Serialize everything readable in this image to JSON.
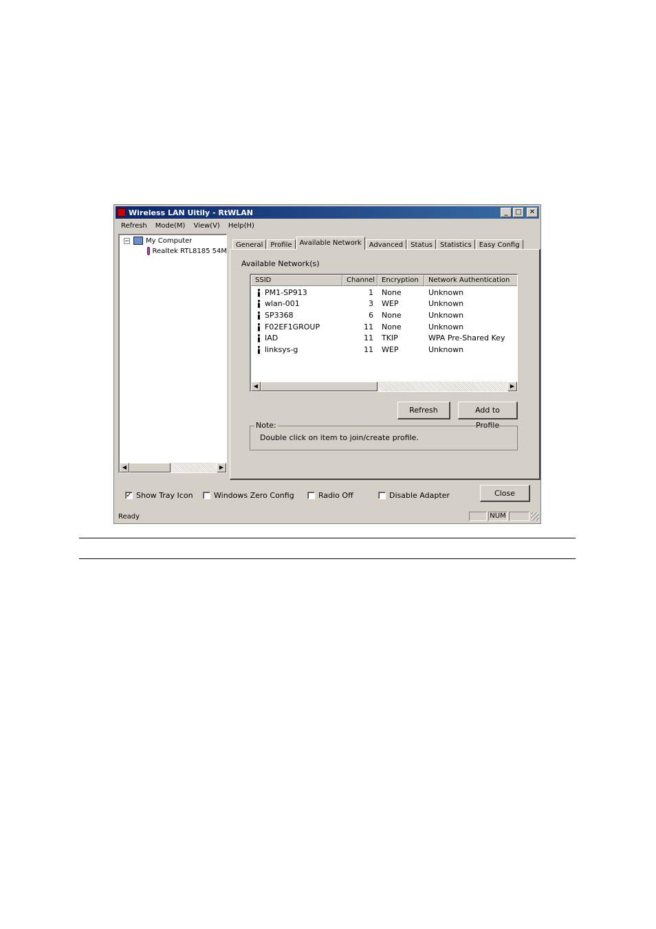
{
  "window": {
    "title": "Wireless LAN Uitily - RtWLAN",
    "minimize_glyph": "_",
    "maximize_glyph": "□",
    "close_glyph": "✕"
  },
  "menu": [
    "Refresh",
    "Mode(M)",
    "View(V)",
    "Help(H)"
  ],
  "tree": {
    "root_expander": "−",
    "root_label": "My Computer",
    "child_label": "Realtek RTL8185 54M"
  },
  "tabs": [
    "General",
    "Profile",
    "Available Network",
    "Advanced",
    "Status",
    "Statistics",
    "Easy Config"
  ],
  "active_tab": "Available Network",
  "available": {
    "section_label": "Available Network(s)",
    "columns": [
      "SSID",
      "Channel",
      "Encryption",
      "Network Authentication"
    ],
    "rows": [
      {
        "ssid": "PM1-SP913",
        "channel": "1",
        "encryption": "None",
        "auth": "Unknown"
      },
      {
        "ssid": "wlan-001",
        "channel": "3",
        "encryption": "WEP",
        "auth": "Unknown"
      },
      {
        "ssid": "SP3368",
        "channel": "6",
        "encryption": "None",
        "auth": "Unknown"
      },
      {
        "ssid": "F02EF1GROUP",
        "channel": "11",
        "encryption": "None",
        "auth": "Unknown"
      },
      {
        "ssid": "IAD",
        "channel": "11",
        "encryption": "TKIP",
        "auth": "WPA Pre-Shared Key"
      },
      {
        "ssid": "linksys-g",
        "channel": "11",
        "encryption": "WEP",
        "auth": "Unknown"
      }
    ],
    "refresh_label": "Refresh",
    "add_profile_label": "Add to Profile",
    "note_legend": "Note:",
    "note_text": "Double click on item to join/create profile."
  },
  "options": {
    "show_tray_icon": {
      "label": "Show Tray Icon",
      "checked": true
    },
    "windows_zero_config": {
      "label": "Windows Zero Config",
      "checked": false
    },
    "radio_off": {
      "label": "Radio Off",
      "checked": false
    },
    "disable_adapter": {
      "label": "Disable Adapter",
      "checked": false
    },
    "check_glyph": "✓"
  },
  "close_label": "Close",
  "status": {
    "text": "Ready",
    "num": "NUM"
  },
  "scroll": {
    "left_arrow": "◀",
    "right_arrow": "▶"
  }
}
